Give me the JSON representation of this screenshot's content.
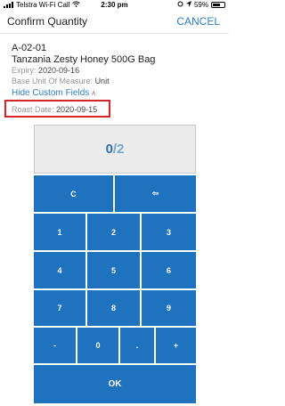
{
  "status_bar": {
    "carrier": "Telstra Wi-Fi Call",
    "time": "2:30 pm",
    "battery": "59%"
  },
  "nav": {
    "title": "Confirm Quantity",
    "cancel": "CANCEL"
  },
  "item": {
    "location": "A-02-01",
    "name": "Tanzania Zesty Honey 500G Bag",
    "expiry_label": "Expiry:",
    "expiry_value": "2020-09-16",
    "uom_label": "Base Unit Of Measure:",
    "uom_value": "Unit"
  },
  "custom_fields": {
    "toggle_label": "Hide Custom Fields",
    "roast_label": "Roast Date:",
    "roast_value": "2020-09-15"
  },
  "quantity": {
    "entered": "0",
    "separator": "/",
    "target": "2"
  },
  "keypad": {
    "clear": "C",
    "backspace": "⇦",
    "k1": "1",
    "k2": "2",
    "k3": "3",
    "k4": "4",
    "k5": "5",
    "k6": "6",
    "k7": "7",
    "k8": "8",
    "k9": "9",
    "minus": "-",
    "k0": "0",
    "dot": ".",
    "plus": "+",
    "ok": "OK"
  },
  "colors": {
    "accent": "#1f72bd",
    "link": "#2f7ec0",
    "highlight_border": "#d9232a"
  }
}
